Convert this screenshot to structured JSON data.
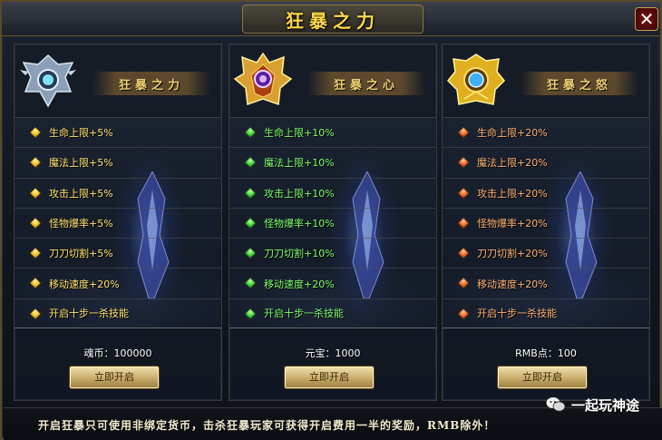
{
  "window": {
    "title": "狂暴之力",
    "close_label": "✕"
  },
  "panels": [
    {
      "name": "狂暴之力",
      "accent": "#ffe36a",
      "rows": [
        "生命上限+5%",
        "魔法上限+5%",
        "攻击上限+5%",
        "怪物爆率+5%",
        "刀刀切割+5%",
        "移动速度+20%",
        "开启十步一杀技能"
      ],
      "cost": "魂币：100000",
      "button": "立即开启"
    },
    {
      "name": "狂暴之心",
      "accent": "#7dff6a",
      "rows": [
        "生命上限+10%",
        "魔法上限+10%",
        "攻击上限+10%",
        "怪物爆率+10%",
        "刀刀切割+10%",
        "移动速度+20%",
        "开启十步一杀技能"
      ],
      "cost": "元宝：1000",
      "button": "立即开启"
    },
    {
      "name": "狂暴之怒",
      "accent": "#ffb070",
      "rows": [
        "生命上限+20%",
        "魔法上限+20%",
        "攻击上限+20%",
        "怪物爆率+20%",
        "刀刀切割+20%",
        "移动速度+20%",
        "开启十步一杀技能"
      ],
      "cost": "RMB点：100",
      "button": "立即开启"
    }
  ],
  "footer": {
    "notice": "开启狂暴只可使用非绑定货币，击杀狂暴玩家可获得开启费用一半的奖励，RMB除外！"
  },
  "watermark": {
    "text": "一起玩神途"
  }
}
